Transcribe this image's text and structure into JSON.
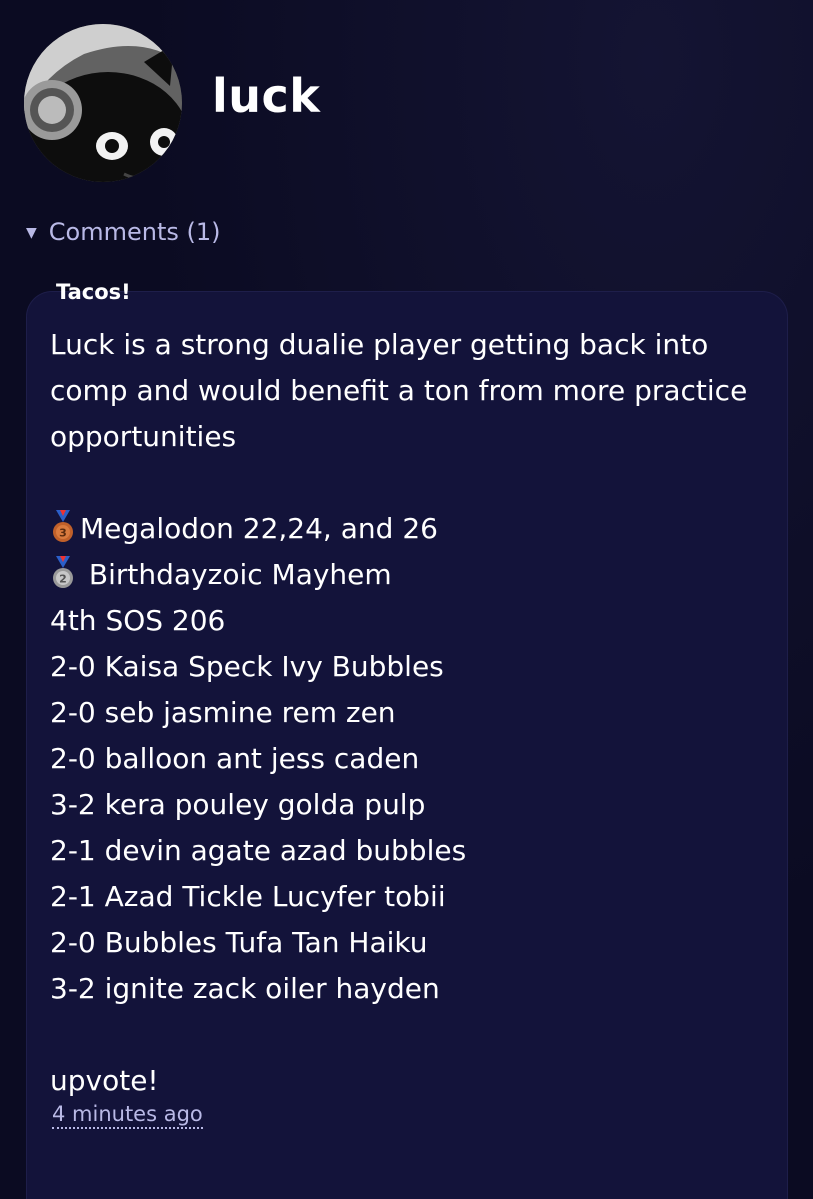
{
  "profile": {
    "username": "luck"
  },
  "comments": {
    "toggle_label": "Comments (1)",
    "items": [
      {
        "author": "Tacos!",
        "intro": "Luck is a strong dualie player getting back into comp and would benefit a ton from more practice opportunities",
        "achievements": [
          {
            "medal": "bronze-medal",
            "text": "Megalodon 22,24, and 26"
          },
          {
            "medal": "silver-medal",
            "text": " Birthdayzoic Mayhem"
          }
        ],
        "results": [
          "4th SOS 206",
          "2-0 Kaisa Speck Ivy Bubbles",
          "2-0 seb jasmine rem zen",
          "2-0 balloon ant jess caden",
          "3-2 kera pouley golda pulp",
          "2-1 devin agate azad bubbles",
          "2-1 Azad Tickle Lucyfer tobii",
          "2-0 Bubbles Tufa Tan Haiku",
          "3-2 ignite zack oiler hayden"
        ],
        "closing": "upvote!",
        "timestamp": "4 minutes ago"
      }
    ]
  },
  "colors": {
    "background": "#0b0b22",
    "card": "#13133a",
    "accent_text": "#b9b9e6"
  }
}
